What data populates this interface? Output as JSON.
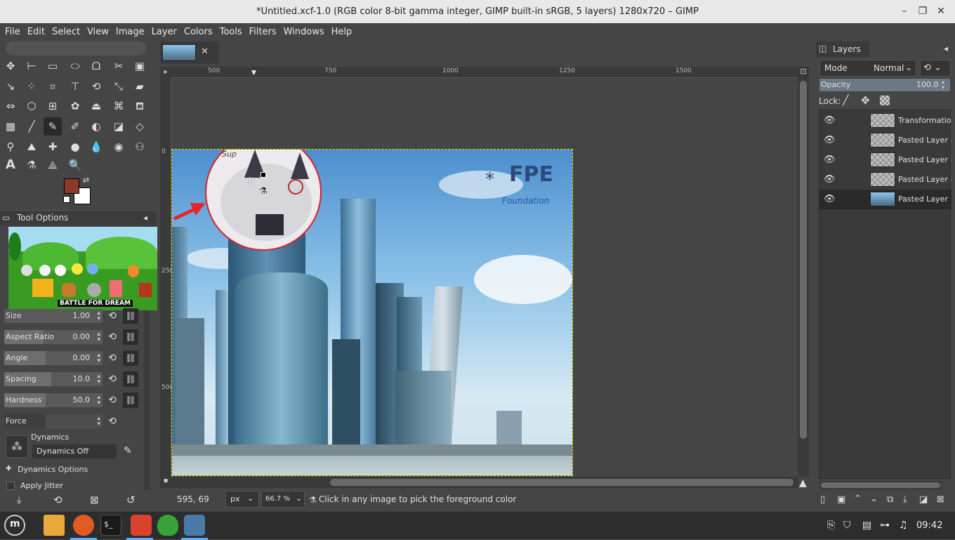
{
  "window": {
    "title": "*Untitled.xcf-1.0 (RGB color 8-bit gamma integer, GIMP built-in sRGB, 5 layers) 1280x720 – GIMP",
    "minimize": "–",
    "maximize": "❐",
    "close": "✕"
  },
  "menu": [
    "File",
    "Edit",
    "Select",
    "View",
    "Image",
    "Layer",
    "Colors",
    "Tools",
    "Filters",
    "Windows",
    "Help"
  ],
  "colors": {
    "foreground": "#8b3a2a",
    "background": "#ffffff",
    "accent": "#5ab0ff"
  },
  "tool_options": {
    "title": "Tool Options",
    "rows": [
      {
        "label": "Size",
        "value": "1.00",
        "fraction": 0.0
      },
      {
        "label": "Aspect Ratio",
        "value": "0.00",
        "fraction": 0.4
      },
      {
        "label": "Angle",
        "value": "0.00",
        "fraction": 0.42
      },
      {
        "label": "Spacing",
        "value": "10.0",
        "fraction": 0.48
      },
      {
        "label": "Hardness",
        "value": "50.0",
        "fraction": 0.42
      },
      {
        "label": "Force",
        "value": "",
        "fraction": 0.42
      }
    ],
    "dynamics_label": "Dynamics",
    "dynamics_value": "Dynamics Off",
    "dynamics_options": "Dynamics Options",
    "apply_jitter": "Apply Jitter",
    "overlay_caption": "BATTLE FOR DREAM"
  },
  "canvas": {
    "tab_close": "✕",
    "ruler_top": [
      "500",
      "750",
      "1000",
      "1250",
      "1500"
    ],
    "ruler_left": [
      "0",
      "250",
      "500"
    ],
    "logo_text": "FPE",
    "logo_sub": "Foundation",
    "sketch_text": "Sup"
  },
  "layers": {
    "title": "Layers",
    "mode_label": "Mode",
    "mode_value": "Normal",
    "opacity_label": "Opacity",
    "opacity_value": "100.0",
    "lock_label": "Lock:",
    "items": [
      {
        "name": "Transformation"
      },
      {
        "name": "Pasted Layer #"
      },
      {
        "name": "Pasted Layer #"
      },
      {
        "name": "Pasted Layer #"
      },
      {
        "name": "Pasted Layer"
      }
    ]
  },
  "status": {
    "coords": "595, 69",
    "unit": "px",
    "zoom": "66.7 %",
    "message": "Click in any image to pick the foreground color"
  },
  "taskbar": {
    "time": "09:42"
  }
}
